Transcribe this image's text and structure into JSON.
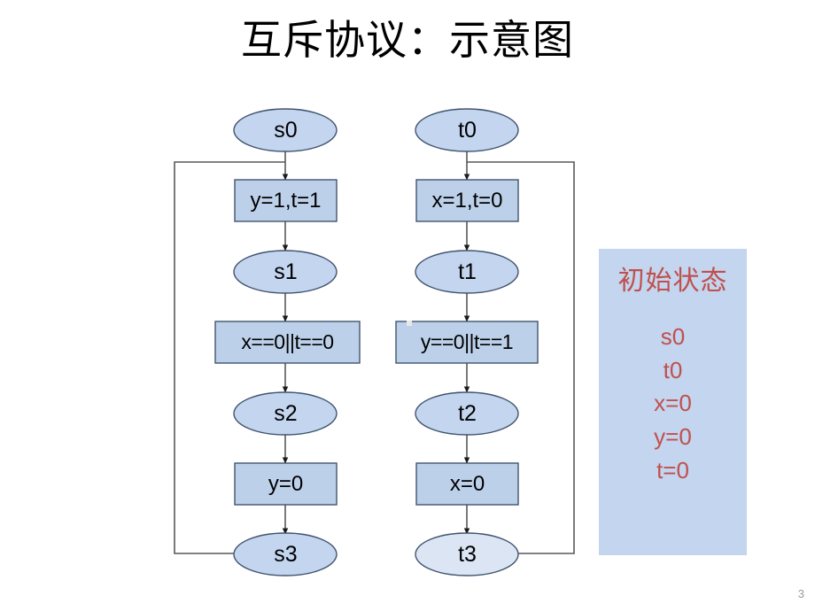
{
  "slide": {
    "title": "互斥协议：示意图",
    "page_number": "3",
    "background_color": "#ffffff"
  },
  "colors": {
    "ellipse_fill": "#c3d5ef",
    "ellipse_fill_light": "#dbe5f4",
    "rect_fill": "#bdd0ea",
    "shape_stroke": "#41546e",
    "edge_stroke": "#595959",
    "panel_fill": "#c3d5ef",
    "panel_text": "#c0504d",
    "title_text": "#000000",
    "page_number_text": "#9b9b9b"
  },
  "diagram": {
    "left_process": {
      "name": "process-s",
      "nodes": [
        {
          "id": "s0",
          "shape": "ellipse",
          "label": "s0"
        },
        {
          "id": "s-act-1",
          "shape": "rect",
          "label": "y=1,t=1"
        },
        {
          "id": "s1",
          "shape": "ellipse",
          "label": "s1"
        },
        {
          "id": "s-cond",
          "shape": "rect",
          "label": "x==0||t==0"
        },
        {
          "id": "s2",
          "shape": "ellipse",
          "label": "s2"
        },
        {
          "id": "s-act-2",
          "shape": "rect",
          "label": "y=0"
        },
        {
          "id": "s3",
          "shape": "ellipse",
          "label": "s3"
        }
      ],
      "loop_back": {
        "from": "s3",
        "to": "s-act-1",
        "side": "left"
      }
    },
    "right_process": {
      "name": "process-t",
      "nodes": [
        {
          "id": "t0",
          "shape": "ellipse",
          "label": "t0"
        },
        {
          "id": "t-act-1",
          "shape": "rect",
          "label": "x=1,t=0"
        },
        {
          "id": "t1",
          "shape": "ellipse",
          "label": "t1"
        },
        {
          "id": "t-cond",
          "shape": "rect",
          "label": "y==0||t==1"
        },
        {
          "id": "t2",
          "shape": "ellipse",
          "label": "t2"
        },
        {
          "id": "t-act-2",
          "shape": "rect",
          "label": "x=0"
        },
        {
          "id": "t3",
          "shape": "ellipse",
          "label": "t3",
          "highlighted": true
        }
      ],
      "loop_back": {
        "from": "t3",
        "to": "t-act-1",
        "side": "right"
      }
    }
  },
  "info_panel": {
    "title": "初始状态",
    "lines": [
      "s0",
      "t0",
      "x=0",
      "y=0",
      "t=0"
    ]
  }
}
